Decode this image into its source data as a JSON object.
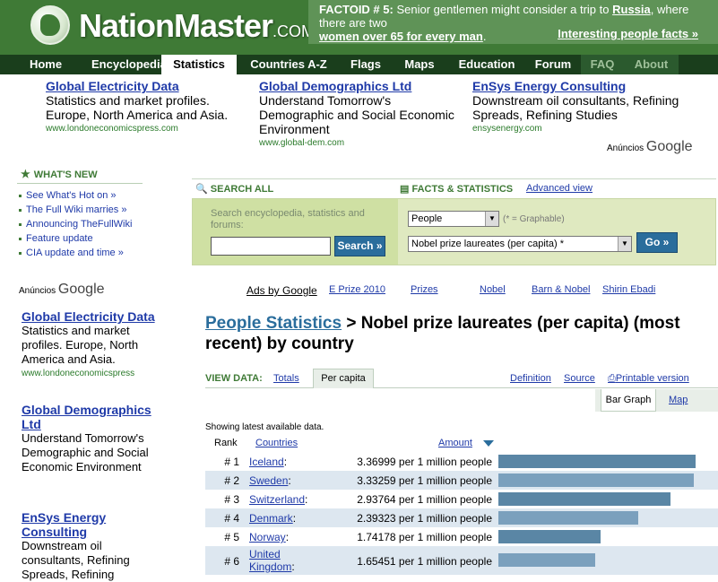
{
  "header": {
    "logo_text": "NationMaster",
    "logo_suffix": ".COM",
    "factoid_label": "FACTOID # 5:",
    "factoid_pre": "Senior gentlemen might consider a trip to",
    "factoid_link": "Russia",
    "factoid_post": ", where there are two",
    "factoid_bold": "women over 65 for every man",
    "factoid_end": ".",
    "factoid_more": "Interesting people facts",
    "factoid_more_arrow": "»"
  },
  "nav": {
    "tabs": [
      "Home",
      "Encyclopedia",
      "Statistics",
      "Countries A-Z",
      "Flags",
      "Maps",
      "Education",
      "Forum",
      "FAQ",
      "About"
    ],
    "active": "Statistics"
  },
  "top_ads": [
    {
      "title": "Global Electricity Data",
      "body": "Statistics and market profiles. Europe, North America and Asia.",
      "url": "www.londoneconomicspress.com"
    },
    {
      "title": "Global Demographics Ltd",
      "body": "Understand Tomorrow's Demographic and Social Economic Environment",
      "url": "www.global-dem.com"
    },
    {
      "title": "EnSys Energy Consulting",
      "body": "Downstream oil consultants, Refining Spreads, Refining Studies",
      "url": "ensysenergy.com"
    }
  ],
  "ads_by": {
    "label": "Anúncios",
    "brand": "Google"
  },
  "whats_new": {
    "heading": "WHAT'S NEW",
    "items": [
      "See What's Hot on »",
      "The Full Wiki marries »",
      "Announcing TheFullWiki",
      "Feature update",
      "CIA update and time »"
    ]
  },
  "side_ads": [
    {
      "title": "Global Electricity Data",
      "body": "Statistics and market profiles. Europe, North America and Asia.",
      "url": "www.londoneconomicspress"
    },
    {
      "title": "Global Demographics Ltd",
      "body": "Understand Tomorrow's Demographic and Social Economic Environment",
      "url": ""
    },
    {
      "title": "EnSys Energy Consulting",
      "body": "Downstream oil consultants, Refining Spreads, Refining",
      "url": ""
    }
  ],
  "search": {
    "search_all": "SEARCH ALL",
    "facts_stats": "FACTS & STATISTICS",
    "advanced": "Advanced view",
    "placeholder": "Search encyclopedia, statistics and forums:",
    "search_button": "Search »",
    "category_value": "People",
    "graphable_note": "(* = Graphable)",
    "stat_value": "Nobel prize laureates (per capita) *",
    "go_button": "Go »"
  },
  "ad_links": [
    "Ads by Google",
    "E Prize 2010",
    "Prizes",
    "Nobel",
    "Barn & Nobel",
    "Shirin Ebadi"
  ],
  "page_title": {
    "link": "People Statistics",
    "rest": " > Nobel prize laureates (per capita) (most recent) by country"
  },
  "view": {
    "label": "VIEW DATA:",
    "totals": "Totals",
    "per_capita": "Per capita",
    "definition": "Definition",
    "source": "Source",
    "printable": "Printable version",
    "bar_graph": "Bar Graph",
    "map": "Map"
  },
  "table": {
    "showing": "Showing latest available data.",
    "col_rank": "Rank",
    "col_countries": "Countries",
    "col_amount": "Amount",
    "rows": [
      {
        "rank": "# 1",
        "country": "Iceland",
        "amount": "3.36999 per 1 million people",
        "value": 3.36999
      },
      {
        "rank": "# 2",
        "country": "Sweden",
        "amount": "3.33259 per 1 million people",
        "value": 3.33259
      },
      {
        "rank": "# 3",
        "country": "Switzerland",
        "amount": "2.93764 per 1 million people",
        "value": 2.93764
      },
      {
        "rank": "# 4",
        "country": "Denmark",
        "amount": "2.39323 per 1 million people",
        "value": 2.39323
      },
      {
        "rank": "# 5",
        "country": "Norway",
        "amount": "1.74178 per 1 million people",
        "value": 1.74178
      },
      {
        "rank": "# 6",
        "country": "United Kingdom",
        "amount": "1.65451 per 1 million people",
        "value": 1.65451
      }
    ]
  },
  "colors": {
    "header_green": "#3f7a36",
    "nav_dark": "#1a3e1c",
    "bar_blue": "#5a86a5",
    "link_blue": "#1f3aa8"
  }
}
